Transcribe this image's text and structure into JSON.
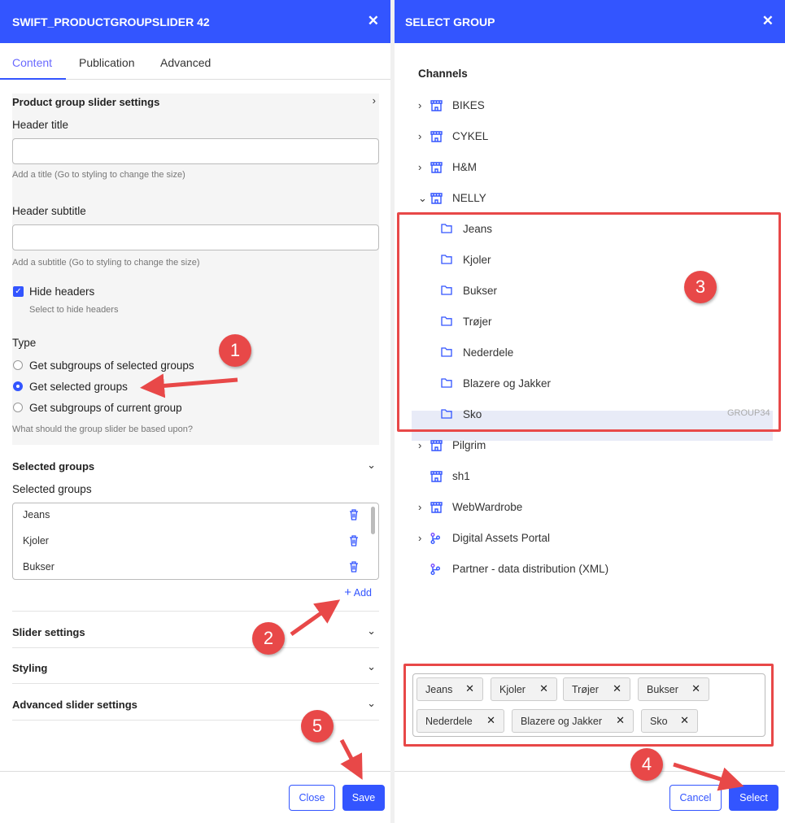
{
  "left": {
    "title": "SWIFT_PRODUCTGROUPSLIDER 42",
    "tabs": [
      "Content",
      "Publication",
      "Advanced"
    ],
    "section_title": "Product group slider settings",
    "header_title_label": "Header title",
    "header_title_value": "",
    "header_title_help": "Add a title (Go to styling to change the size)",
    "header_subtitle_label": "Header subtitle",
    "header_subtitle_value": "",
    "header_subtitle_help": "Add a subtitle (Go to styling to change the size)",
    "hide_headers_label": "Hide headers",
    "hide_headers_checked": true,
    "hide_headers_help": "Select to hide headers",
    "type_label": "Type",
    "type_options": [
      "Get subgroups of selected groups",
      "Get selected groups",
      "Get subgroups of current group"
    ],
    "type_selected": "Get selected groups",
    "type_help": "What should the group slider be based upon?",
    "selected_groups_section": "Selected groups",
    "selected_groups_label": "Selected groups",
    "selected_groups": [
      "Jeans",
      "Kjoler",
      "Bukser"
    ],
    "add_label": "Add",
    "collapsed_sections": [
      "Slider settings",
      "Styling",
      "Advanced slider settings"
    ],
    "close_label": "Close",
    "save_label": "Save"
  },
  "right": {
    "title": "SELECT GROUP",
    "tree_heading": "Channels",
    "channels_top": [
      "BIKES",
      "CYKEL",
      "H&M",
      "NELLY"
    ],
    "nelly_children": [
      "Jeans",
      "Kjoler",
      "Bukser",
      "Trøjer",
      "Nederdele",
      "Blazere og Jakker",
      "Sko"
    ],
    "highlight_id": "GROUP34",
    "channels_bottom": [
      "Pilgrim",
      "sh1",
      "WebWardrobe",
      "Digital Assets Portal",
      "Partner - data distribution (XML)"
    ],
    "chips": [
      "Jeans",
      "Kjoler",
      "Trøjer",
      "Bukser",
      "Nederdele",
      "Blazere og Jakker",
      "Sko"
    ],
    "cancel_label": "Cancel",
    "select_label": "Select"
  },
  "annotations": [
    "1",
    "2",
    "3",
    "4",
    "5"
  ],
  "colors": {
    "accent": "#3355ff",
    "annotation": "#e84848"
  }
}
